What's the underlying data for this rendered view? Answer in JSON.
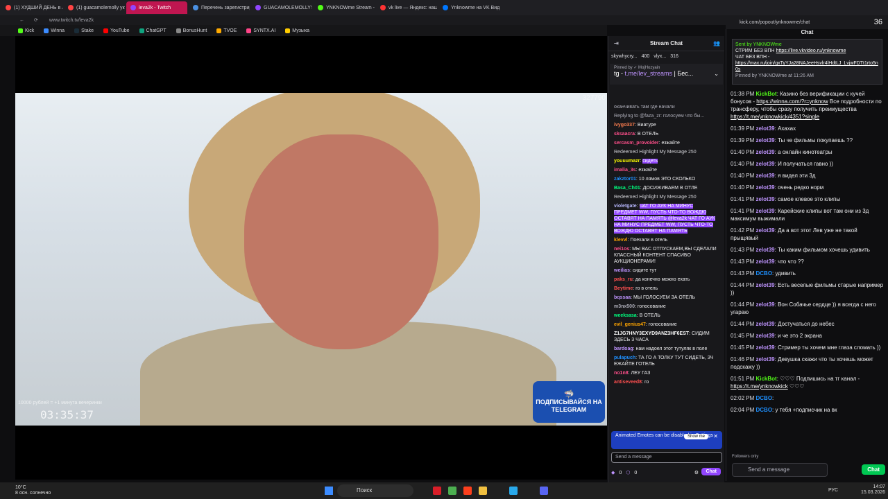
{
  "browser": {
    "tabs": [
      {
        "label": "(1) ХУДШИЙ ДЕНЬ в АФР",
        "color": "#ff4444",
        "active": false
      },
      {
        "label": "(1) guacamolemolly укуре",
        "color": "#ff4444",
        "active": false
      },
      {
        "label": "leva2k - Twitch",
        "color": "#9146ff",
        "active": true
      },
      {
        "label": "Перечень зарегистриро",
        "color": "#4a90e2",
        "active": false
      },
      {
        "label": "GUACAMOLEMOLLY's Vi",
        "color": "#9146ff",
        "active": false
      },
      {
        "label": "YNKNOWme Stream - Wi",
        "color": "#53fc18",
        "active": false
      },
      {
        "label": "vk live — Яндекс: нашёл",
        "color": "#ff3333",
        "active": false
      },
      {
        "label": "Ynknowme на VK Видео",
        "color": "#0077ff",
        "active": false
      }
    ],
    "url": "www.twitch.tv/leva2k",
    "popout_url": "kick.com/popout/ynknowme/chat",
    "counter": "36",
    "bookmarks": [
      {
        "label": "Kick",
        "color": "#53fc18"
      },
      {
        "label": "Winna",
        "color": "#3c8cff"
      },
      {
        "label": "Stake",
        "color": "#1a2c38"
      },
      {
        "label": "YouTube",
        "color": "#ff0000"
      },
      {
        "label": "ChatGPT",
        "color": "#10a37f"
      },
      {
        "label": "BonusHunt",
        "color": "#888888"
      },
      {
        "label": "TVOE",
        "color": "#ffaa00"
      },
      {
        "label": "SYNTX.AI",
        "color": "#ff4488"
      },
      {
        "label": "Музыка",
        "color": "#ffcc00"
      }
    ]
  },
  "video": {
    "timer": "03:35:37",
    "small_stat": "10000 рублей = +1 минута вечеринки",
    "corner_text": "327790",
    "tg_badge": "ПОДПИСЫВАЙСЯ НА TELEGRAM"
  },
  "stream_chat": {
    "title": "Stream Chat",
    "leaders": [
      {
        "name": "skywhycry...",
        "value": "400"
      },
      {
        "name": "vlyx...",
        "value": "316"
      }
    ],
    "pinned_by": "Pinned by ✓ MojHozyain",
    "pinned_msg_prefix": "tg - ",
    "pinned_msg_link": "t.me/lev_streams",
    "pinned_msg_suffix": " | Бес...",
    "messages": [
      {
        "user": "",
        "color": "#adadb8",
        "text": "оканчивать там где начали",
        "type": "plain"
      },
      {
        "user": "",
        "color": "#adadb8",
        "text": "Replying to @faza_zr: голосуем что бы...",
        "type": "reply"
      },
      {
        "user": "ivygo337",
        "color": "#ff7f50",
        "text": "Виатуре",
        "type": "plain"
      },
      {
        "user": "sksaacra",
        "color": "#ff4f8b",
        "text": "В ОТЕЛЬ",
        "type": "plain"
      },
      {
        "user": "sercasm_provoider",
        "color": "#ff4f8b",
        "text": "езжайте",
        "type": "plain"
      },
      {
        "user": "",
        "color": "#cfcfd4",
        "text": "Redeemed Highlight My Message  250",
        "type": "redeem"
      },
      {
        "user": "youuumazr",
        "color": "#ffff00",
        "text": "сидеть",
        "type": "hl"
      },
      {
        "user": "imalia_3s",
        "color": "#ff4f8b",
        "text": "езжайте",
        "type": "plain"
      },
      {
        "user": "zakztor01",
        "color": "#1e90ff",
        "text": "10 лямов ЭТО СКОЛЬКО",
        "type": "plain"
      },
      {
        "user": "Basa_Ch01",
        "color": "#00ff7f",
        "text": "ДОСИЖИВАЕМ В ОТЛЕ",
        "type": "plain"
      },
      {
        "user": "",
        "color": "#cfcfd4",
        "text": "Redeemed Highlight My Message  250",
        "type": "redeem"
      },
      {
        "user": "violetgate",
        "color": "#b8b8ff",
        "text": "ЧАТ ГО АУК НА МИНУС ПРЕДМЕТ WW, ПУСТЬ ЧТО-ТО ВОЖДЮ ОСТАВЯТ НА ПАМЯТЬ @leva2k ЧАТ ГО АУК НА МИНУС ПРЕДМЕТ WW, ПУСТЬ ЧТО-ТО ВОЖДЮ ОСТАВЯТ НА ПАМЯТЬ",
        "type": "hl"
      },
      {
        "user": "klevvl",
        "color": "#ffa500",
        "text": "Поехали в отель",
        "type": "plain"
      },
      {
        "user": "nei1os",
        "color": "#ff4f8b",
        "text": "МЫ ВАС ОТПУСКАЕМ,ВЫ СДЕЛАЛИ КЛАССНЫЙ КОНТЕНТ СПАСИБО АУКЦИОНЕРАМИ!",
        "type": "plain"
      },
      {
        "user": "weilias",
        "color": "#bf94ff",
        "text": "сидите тут",
        "type": "plain"
      },
      {
        "user": "paks_ru",
        "color": "#ff4f4f",
        "text": "да конечно можно ехать",
        "type": "plain"
      },
      {
        "user": "Beytime",
        "color": "#ff4f4f",
        "text": "го в отель",
        "type": "plain"
      },
      {
        "user": "bqssaa",
        "color": "#bf94ff",
        "text": "МЫ ГОЛОСУЕМ ЗА ОТЕЛЬ",
        "type": "plain"
      },
      {
        "user": "m3nx500",
        "color": "#adadb8",
        "text": "голосование",
        "type": "plain"
      },
      {
        "user": "weeksasa",
        "color": "#00ff7f",
        "text": "В ОТЕЛЬ",
        "type": "plain"
      },
      {
        "user": "evil_genius47",
        "color": "#ffa500",
        "text": "голосование",
        "type": "plain"
      },
      {
        "user": "Z1JG7HNY3EXYD9ANZ3HF6EST",
        "color": "#ffffff",
        "text": "СИДИМ ЗДЕСЬ 3 ЧАСА",
        "type": "plain"
      },
      {
        "user": "bardoag",
        "color": "#bf94ff",
        "text": "нам надоел этот тутуляк в поле",
        "type": "plain"
      },
      {
        "user": "pulapuch",
        "color": "#1e90ff",
        "text": "ТА ГО А ТОЛКУ ТУТ СИДЕТЬ, ЗЧ ЕЖАЙТЕ ГОТЕЛЬ",
        "type": "plain"
      },
      {
        "user": "no1n8",
        "color": "#ff4f8b",
        "text": "ЛЕУ ГАЗ",
        "type": "plain"
      },
      {
        "user": "antiseveed8",
        "color": "#ff4f4f",
        "text": "го",
        "type": "plain"
      }
    ],
    "emote_note": "Animated Emotes can be disabled in Settings",
    "show_me": "Show me",
    "input_placeholder": "Send a message",
    "points_a": "0",
    "points_b": "0",
    "chat_button": "Chat"
  },
  "popout_chat": {
    "title": "Chat",
    "pinned": {
      "sent_by": "Sent by YNKNOWme",
      "line1": "СТРИМ БЕЗ ВПН",
      "link1": "https://live.vkvideo.ru/ynknowme",
      "line2": "ЧАТ БЕЗ ВПН -",
      "link2": "https://max.ru/join/gxTyYJa28NAJeeHsvlr4lHdtLJ_LvjwFDTt1rto5n0s",
      "pinned_by": "Pinned by YNKNOWme at 11:26 AM"
    },
    "messages": [
      {
        "time": "01:38 PM",
        "user": "KickBot",
        "color": "#53fc18",
        "text": "Казино без верификации с кучей бонусов - ",
        "link": "https://winna.com/?r=ynknow",
        "text2": " Все подробности по трансферу, чтобы сразу получить преимущества ",
        "link2": "https://t.me/ynknowkick/4351?single"
      },
      {
        "time": "01:39 PM",
        "user": "zelot39",
        "color": "#bf94ff",
        "text": "Ахахах"
      },
      {
        "time": "01:39 PM",
        "user": "zelot39",
        "color": "#bf94ff",
        "text": "Ты че фильмы покупаешь ??"
      },
      {
        "time": "01:40 PM",
        "user": "zelot39",
        "color": "#bf94ff",
        "text": "а онлайн кинотеатры"
      },
      {
        "time": "01:40 PM",
        "user": "zelot39",
        "color": "#bf94ff",
        "text": "И получаться гавно ))"
      },
      {
        "time": "01:40 PM",
        "user": "zelot39",
        "color": "#bf94ff",
        "text": "я видел эти 3д"
      },
      {
        "time": "01:40 PM",
        "user": "zelot39",
        "color": "#bf94ff",
        "text": "очень редко норм"
      },
      {
        "time": "01:41 PM",
        "user": "zelot39",
        "color": "#bf94ff",
        "text": "самое клевое это клипы"
      },
      {
        "time": "01:41 PM",
        "user": "zelot39",
        "color": "#bf94ff",
        "text": "Карейские клипы вот там они из 3д максимум выжимали"
      },
      {
        "time": "01:42 PM",
        "user": "zelot39",
        "color": "#bf94ff",
        "text": "Да а вот этот Лев уже не такой прыщявый"
      },
      {
        "time": "01:43 PM",
        "user": "zelot39",
        "color": "#bf94ff",
        "text": "Ты каким фильмом хочешь удивить"
      },
      {
        "time": "01:43 PM",
        "user": "zelot39",
        "color": "#bf94ff",
        "text": "что что ??"
      },
      {
        "time": "01:43 PM",
        "user": "DCBO",
        "color": "#1e90ff",
        "text": "удивить"
      },
      {
        "time": "01:44 PM",
        "user": "zelot39",
        "color": "#bf94ff",
        "text": "Есть веселые фильмы старые например ))"
      },
      {
        "time": "01:44 PM",
        "user": "zelot39",
        "color": "#bf94ff",
        "text": "Вон Собачье сердце )) я всегда с него угараю"
      },
      {
        "time": "01:44 PM",
        "user": "zelot39",
        "color": "#bf94ff",
        "text": "Достучаться до небес"
      },
      {
        "time": "01:45 PM",
        "user": "zelot39",
        "color": "#bf94ff",
        "text": "и че это 2 экрана"
      },
      {
        "time": "01:45 PM",
        "user": "zelot39",
        "color": "#bf94ff",
        "text": "Стример ты хочем мне глаза сломать ))"
      },
      {
        "time": "01:46 PM",
        "user": "zelot39",
        "color": "#bf94ff",
        "text": "Девушка скажи что ты хочешь может подскажу ))"
      },
      {
        "time": "01:51 PM",
        "user": "KickBot",
        "color": "#53fc18",
        "text": "♡♡♡ Подпишись на тг канал - ",
        "link": "https://t.me/ynknowkick",
        "text2": " ♡♡♡",
        "link2": ""
      },
      {
        "time": "02:02 PM",
        "user": "DCBO",
        "color": "#1e90ff",
        "text": ""
      },
      {
        "time": "02:04 PM",
        "user": "DCBO",
        "color": "#1e90ff",
        "text": "у тебя +подписчик на вк"
      }
    ],
    "followers_only": "Followers only",
    "input_placeholder": "Send a message",
    "chat_button": "Chat"
  },
  "taskbar": {
    "temp": "10°C",
    "weather": "8 осн. солнечно",
    "search": "Поиск",
    "lang": "РУС",
    "time": "14:07",
    "date": "15.03.2026"
  }
}
